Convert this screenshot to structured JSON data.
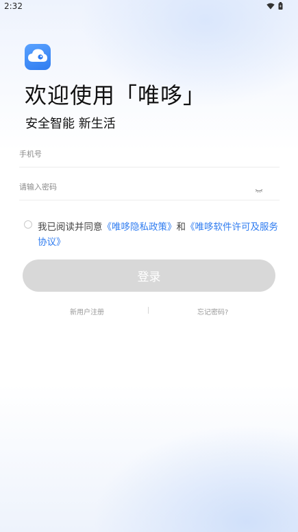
{
  "status_bar": {
    "time": "2:32",
    "icons": [
      "wifi-icon",
      "battery-icon"
    ]
  },
  "app": {
    "logo_icon": "cloud-eye-icon"
  },
  "welcome": {
    "title": "欢迎使用「唯哆」",
    "subtitle": "安全智能 新生活"
  },
  "form": {
    "phone_placeholder": "手机号",
    "password_placeholder": "请输入密码",
    "password_toggle_icon": "eye-closed-icon"
  },
  "agreement": {
    "prefix": "我已阅读并同意",
    "privacy_link": "《唯哆隐私政策》",
    "and": "和",
    "license_link": "《唯哆软件许可及服务协议》"
  },
  "login_button": {
    "label": "登录"
  },
  "links": {
    "register": "新用户注册",
    "forgot": "忘记密码?"
  },
  "colors": {
    "accent": "#2f7cf0",
    "button_disabled": "#d8d8d8"
  }
}
